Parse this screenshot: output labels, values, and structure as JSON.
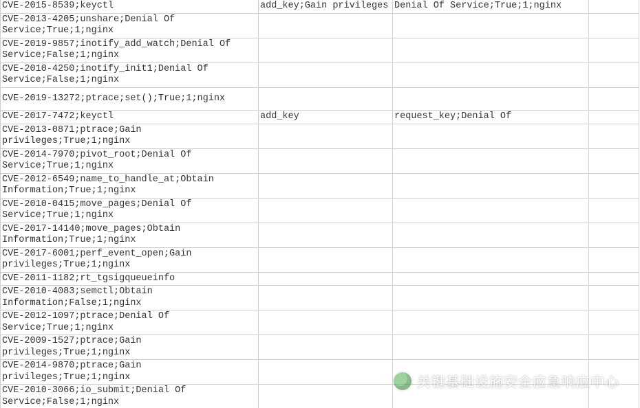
{
  "rows": [
    {
      "c0": "CVE-2015-8539;keyctl",
      "c1": "add_key;Gain privileges",
      "c2": "Denial Of Service;True;1;nginx",
      "c3": ""
    },
    {
      "c0": "CVE-2013-4205;unshare;Denial Of Service;True;1;nginx",
      "c1": "",
      "c2": "",
      "c3": ""
    },
    {
      "c0": "CVE-2019-9857;inotify_add_watch;Denial Of Service;False;1;nginx",
      "c1": "",
      "c2": "",
      "c3": ""
    },
    {
      "c0": "CVE-2010-4250;inotify_init1;Denial Of Service;False;1;nginx",
      "c1": "",
      "c2": "",
      "c3": ""
    },
    {
      "c0": "CVE-2019-13272;ptrace;set();True;1;nginx",
      "c1": "",
      "c2": "",
      "c3": "",
      "tall": true
    },
    {
      "c0": "CVE-2017-7472;keyctl",
      "c1": "add_key",
      "c2": "request_key;Denial Of",
      "c3": ""
    },
    {
      "c0": "CVE-2013-0871;ptrace;Gain privileges;True;1;nginx",
      "c1": "",
      "c2": "",
      "c3": ""
    },
    {
      "c0": "CVE-2014-7970;pivot_root;Denial Of Service;True;1;nginx",
      "c1": "",
      "c2": "",
      "c3": ""
    },
    {
      "c0": "CVE-2012-6549;name_to_handle_at;Obtain Information;True;1;nginx",
      "c1": "",
      "c2": "",
      "c3": ""
    },
    {
      "c0": "CVE-2010-0415;move_pages;Denial Of Service;True;1;nginx",
      "c1": "",
      "c2": "",
      "c3": ""
    },
    {
      "c0": "CVE-2017-14140;move_pages;Obtain Information;True;1;nginx",
      "c1": "",
      "c2": "",
      "c3": ""
    },
    {
      "c0": "CVE-2017-6001;perf_event_open;Gain privileges;True;1;nginx",
      "c1": "",
      "c2": "",
      "c3": ""
    },
    {
      "c0": "CVE-2011-1182;rt_tgsigqueueinfo",
      "c1": "",
      "c2": "",
      "c3": ""
    },
    {
      "c0": "CVE-2010-4083;semctl;Obtain Information;False;1;nginx",
      "c1": "",
      "c2": "",
      "c3": ""
    },
    {
      "c0": "CVE-2012-1097;ptrace;Denial Of Service;True;1;nginx",
      "c1": "",
      "c2": "",
      "c3": ""
    },
    {
      "c0": "CVE-2009-1527;ptrace;Gain privileges;True;1;nginx",
      "c1": "",
      "c2": "",
      "c3": ""
    },
    {
      "c0": "CVE-2014-9870;ptrace;Gain privileges;True;1;nginx",
      "c1": "",
      "c2": "",
      "c3": ""
    },
    {
      "c0": "CVE-2010-3066;io_submit;Denial Of Service;False;1;nginx",
      "c1": "",
      "c2": "",
      "c3": ""
    }
  ],
  "watermark_text": "关键基础设施安全应急响应中心"
}
